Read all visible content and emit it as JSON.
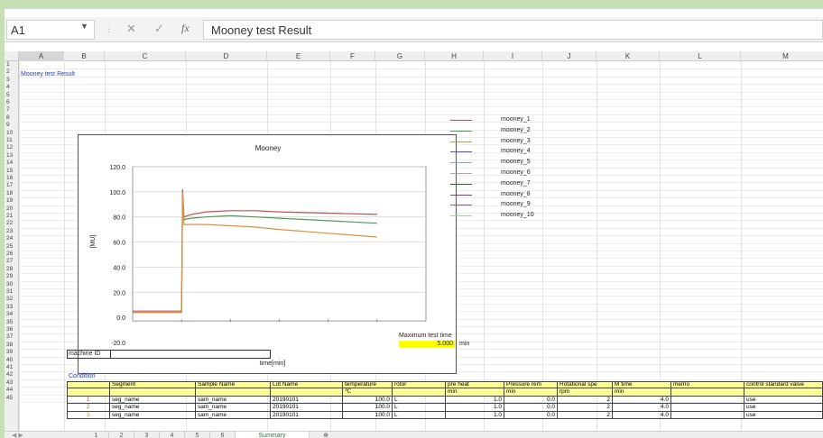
{
  "formula_bar": {
    "cell_ref": "A1",
    "fx": "fx",
    "content": "Mooney test Result"
  },
  "columns": [
    "A",
    "B",
    "C",
    "D",
    "E",
    "F",
    "G",
    "H",
    "I",
    "J",
    "K",
    "L",
    "M"
  ],
  "rows": [
    "1",
    "2",
    "3",
    "4",
    "5",
    "6",
    "7",
    "8",
    "9",
    "10",
    "11",
    "12",
    "13",
    "14",
    "15",
    "16",
    "17",
    "18",
    "19",
    "20",
    "21",
    "22",
    "23",
    "24",
    "25",
    "26",
    "27",
    "28",
    "29",
    "30",
    "31",
    "32",
    "33",
    "34",
    "35",
    "36",
    "37",
    "38",
    "39",
    "40",
    "41",
    "42",
    "43",
    "44",
    "45"
  ],
  "sheet": {
    "title_cell": "Mooney test Result",
    "max_test_time_label": "Maximum test time",
    "max_test_time_value": "5.000",
    "max_test_time_unit": "min",
    "machine_id_label": "machine ID",
    "condition_label": "Condition"
  },
  "chart_data": {
    "type": "line",
    "title": "Mooney",
    "ylabel": "[MU]",
    "xlabel": "time[min]",
    "y_ticks": [
      "120.0",
      "100.0",
      "80.0",
      "60.0",
      "40.0",
      "20.0",
      "0.0",
      "-20.0"
    ],
    "ylim": [
      -20,
      120
    ],
    "xlim": [
      -1,
      5
    ],
    "grid": true,
    "series": [
      {
        "name": "mooney_1",
        "color": "#c0504d",
        "x": [
          -1,
          -0.5,
          0,
          0.02,
          0.05,
          0.2,
          0.5,
          1,
          1.5,
          2,
          3,
          4
        ],
        "y": [
          5,
          5,
          5,
          102,
          80,
          82,
          84,
          85,
          85,
          84,
          83,
          82
        ]
      },
      {
        "name": "mooney_2",
        "color": "#4f9a4f",
        "x": [
          -1,
          -0.5,
          0,
          0.02,
          0.05,
          0.2,
          0.5,
          1,
          1.5,
          2,
          3,
          4
        ],
        "y": [
          4,
          4,
          4,
          97,
          78,
          79,
          80,
          81,
          80,
          79,
          77,
          75
        ]
      },
      {
        "name": "mooney_3",
        "color": "#e08f3a",
        "x": [
          -1,
          -0.5,
          0,
          0.02,
          0.05,
          0.2,
          0.5,
          1,
          1.5,
          2,
          3,
          4
        ],
        "y": [
          4,
          4,
          4,
          100,
          74,
          74,
          74,
          73,
          72,
          70,
          67,
          64
        ]
      }
    ],
    "legend": [
      "mooney_1",
      "mooney_2",
      "mooney_3",
      "mooney_4",
      "mooney_5",
      "mooney_6",
      "mooney_7",
      "mooney_8",
      "mooney_9",
      "mooney_10"
    ],
    "legend_colors": [
      "#c0504d",
      "#4f9a4f",
      "#e08f3a",
      "#5b4fb0",
      "#7aa7d8",
      "#a8a8a8",
      "#2f5f2f",
      "#8b3a8b",
      "#9b4f9b",
      "#8fe08f"
    ]
  },
  "table": {
    "headers": [
      "Segment",
      "Sample Name",
      "Lot Name",
      "temperature",
      "rotor",
      "pre heat",
      "Pressure rem",
      "Rotational spe",
      "M time",
      "memo",
      "control standard value"
    ],
    "units": [
      "",
      "",
      "",
      "℃",
      "",
      "min",
      "min",
      "rpm",
      "min",
      "",
      ""
    ],
    "rows": [
      {
        "no": "1",
        "no_color": "#c0504d",
        "cells": [
          "seg_name",
          "sam_name",
          "20190101",
          "100.0",
          "L",
          "1.0",
          "0.0",
          "2",
          "4.0",
          "",
          "use"
        ]
      },
      {
        "no": "2",
        "no_color": "#4f9a4f",
        "cells": [
          "seg_name",
          "sam_name",
          "20190101",
          "100.0",
          "L",
          "1.0",
          "0.0",
          "2",
          "4.0",
          "",
          "use"
        ]
      },
      {
        "no": "3",
        "no_color": "#e08f3a",
        "cells": [
          "seg_name",
          "sam_name",
          "20190101",
          "100.0",
          "L",
          "1.0",
          "0.0",
          "2",
          "4.0",
          "",
          "use"
        ]
      }
    ]
  },
  "tabs": [
    "1",
    "2",
    "3",
    "4",
    "5",
    "6",
    "Summary"
  ],
  "active_tab": "Summary",
  "add_sheet": "⊕"
}
